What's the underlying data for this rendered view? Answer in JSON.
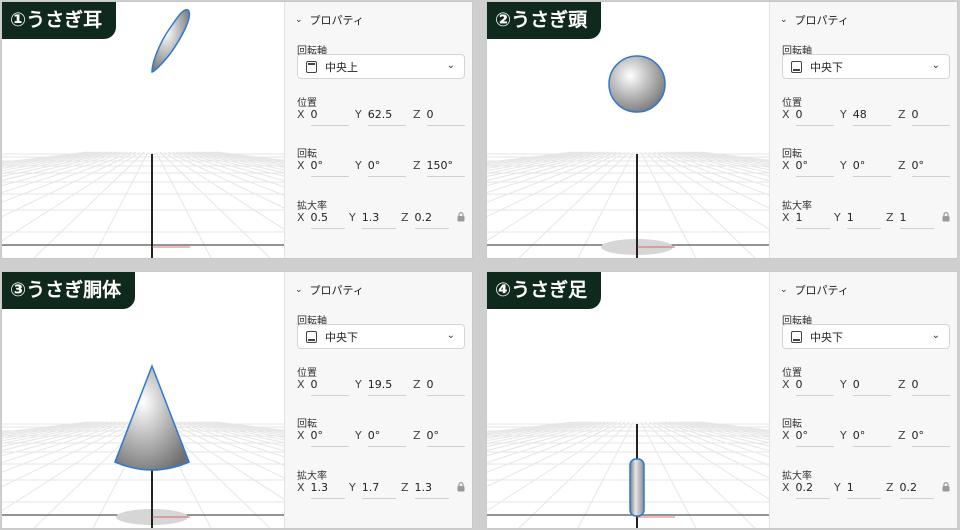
{
  "panels": [
    {
      "id": "p1",
      "title": "①うさぎ耳",
      "section_title": "プロパティ",
      "pivot_label": "回転軸",
      "pivot_value": "中央上",
      "pivot_icon": "pivot-top-icon",
      "position_label": "位置",
      "position": {
        "x": "0",
        "y": "62.5",
        "z": "0"
      },
      "rotation_label": "回転",
      "rotation": {
        "x": "0°",
        "y": "0°",
        "z": "150°"
      },
      "scale_label": "拡大率",
      "scale": {
        "x": "0.5",
        "y": "1.3",
        "z": "0.2"
      },
      "object": "ear"
    },
    {
      "id": "p2",
      "title": "②うさぎ頭",
      "section_title": "プロパティ",
      "pivot_label": "回転軸",
      "pivot_value": "中央下",
      "pivot_icon": "pivot-bottom-icon",
      "position_label": "位置",
      "position": {
        "x": "0",
        "y": "48",
        "z": "0"
      },
      "rotation_label": "回転",
      "rotation": {
        "x": "0°",
        "y": "0°",
        "z": "0°"
      },
      "scale_label": "拡大率",
      "scale": {
        "x": "1",
        "y": "1",
        "z": "1"
      },
      "object": "head"
    },
    {
      "id": "p3",
      "title": "③うさぎ胴体",
      "section_title": "プロパティ",
      "pivot_label": "回転軸",
      "pivot_value": "中央下",
      "pivot_icon": "pivot-bottom-icon",
      "position_label": "位置",
      "position": {
        "x": "0",
        "y": "19.5",
        "z": "0"
      },
      "rotation_label": "回転",
      "rotation": {
        "x": "0°",
        "y": "0°",
        "z": "0°"
      },
      "scale_label": "拡大率",
      "scale": {
        "x": "1.3",
        "y": "1.7",
        "z": "1.3"
      },
      "object": "body"
    },
    {
      "id": "p4",
      "title": "④うさぎ足",
      "section_title": "プロパティ",
      "pivot_label": "回転軸",
      "pivot_value": "中央下",
      "pivot_icon": "pivot-bottom-icon",
      "position_label": "位置",
      "position": {
        "x": "0",
        "y": "0",
        "z": "0"
      },
      "rotation_label": "回転",
      "rotation": {
        "x": "0°",
        "y": "0°",
        "z": "0°"
      },
      "scale_label": "拡大率",
      "scale": {
        "x": "0.2",
        "y": "1",
        "z": "0.2"
      },
      "object": "leg"
    }
  ],
  "axis_letters": {
    "x": "X",
    "y": "Y",
    "z": "Z"
  },
  "colors": {
    "label_bg": "#0f2a1d",
    "outline": "#2f78d0",
    "grid": "#e6e6e6",
    "axis_red": "#d23b3b"
  }
}
